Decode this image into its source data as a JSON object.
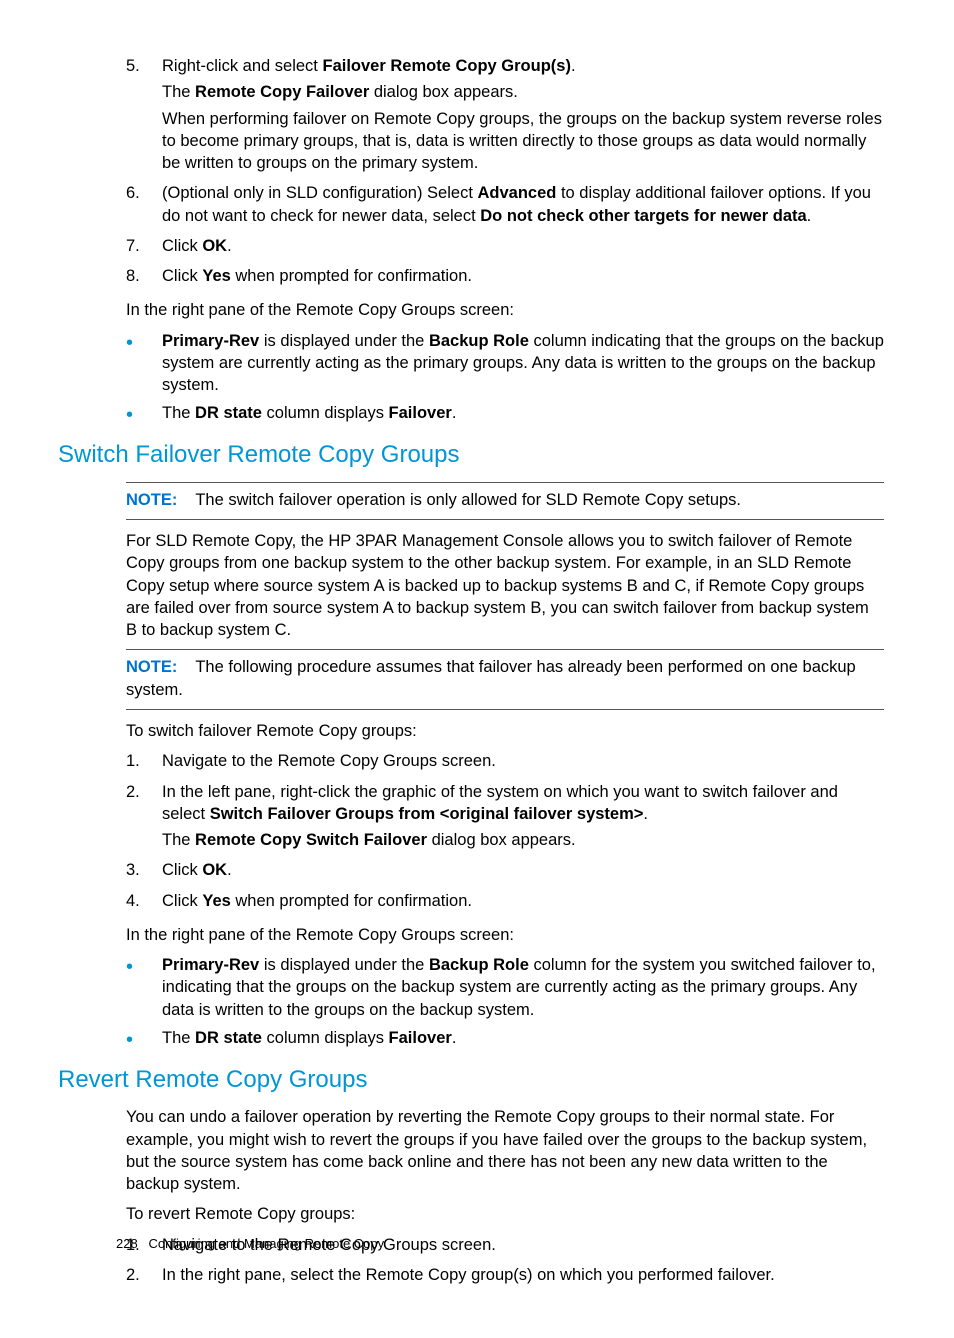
{
  "top_list": {
    "item5": {
      "num": "5.",
      "p1a": "Right-click and select ",
      "p1b": "Failover Remote Copy Group(s)",
      "p1c": ".",
      "p2a": "The ",
      "p2b": "Remote Copy Failover",
      "p2c": " dialog box appears.",
      "p3": "When performing failover on Remote Copy groups, the groups on the backup system reverse roles to become primary groups, that is, data is written directly to those groups as data would normally be written to groups on the primary system."
    },
    "item6": {
      "num": "6.",
      "p1a": "(Optional only in SLD configuration) Select ",
      "p1b": "Advanced",
      "p1c": " to display additional failover options. If you do not want to check for newer data, select ",
      "p1d": "Do not check other targets for newer data",
      "p1e": "."
    },
    "item7": {
      "num": "7.",
      "a": "Click ",
      "b": "OK",
      "c": "."
    },
    "item8": {
      "num": "8.",
      "a": "Click ",
      "b": "Yes",
      "c": " when prompted for confirmation."
    }
  },
  "top_after": {
    "intro": "In the right pane of the Remote Copy Groups screen:",
    "b1": {
      "a": "Primary-Rev",
      "b": " is displayed under the ",
      "c": "Backup Role",
      "d": " column indicating that the groups on the backup system are currently acting as the primary groups. Any data is written to the groups on the backup system."
    },
    "b2": {
      "a": "The ",
      "b": "DR state",
      "c": " column displays ",
      "d": "Failover",
      "e": "."
    }
  },
  "switch": {
    "heading": "Switch Failover Remote Copy Groups",
    "note1_label": "NOTE:",
    "note1_text": "The switch failover operation is only allowed for SLD Remote Copy setups.",
    "para1": "For SLD Remote Copy, the HP 3PAR Management Console allows you to switch failover of Remote Copy groups from one backup system to the other backup system. For example, in an SLD Remote Copy setup where source system A is backed up to backup systems B and C, if Remote Copy groups are failed over from source system A to backup system B, you can switch failover from backup system B to backup system C.",
    "note2_label": "NOTE:",
    "note2_text": "The following procedure assumes that failover has already been performed on one backup system.",
    "intro": "To switch failover Remote Copy groups:",
    "s1": {
      "num": "1.",
      "t": "Navigate to the Remote Copy Groups screen."
    },
    "s2": {
      "num": "2.",
      "a": "In the left pane, right-click the graphic of the system on which you want to switch failover and select ",
      "b": "Switch Failover Groups from <original failover system>",
      "c": ".",
      "p2a": "The ",
      "p2b": "Remote Copy Switch Failover",
      "p2c": " dialog box appears."
    },
    "s3": {
      "num": "3.",
      "a": "Click ",
      "b": "OK",
      "c": "."
    },
    "s4": {
      "num": "4.",
      "a": "Click ",
      "b": "Yes",
      "c": " when prompted for confirmation."
    },
    "after_intro": "In the right pane of the Remote Copy Groups screen:",
    "b1": {
      "a": "Primary-Rev",
      "b": " is displayed under the ",
      "c": "Backup Role",
      "d": " column for the system you switched failover to, indicating that the groups on the backup system are currently acting as the primary groups. Any data is written to the groups on the backup system."
    },
    "b2": {
      "a": "The ",
      "b": "DR state",
      "c": " column displays ",
      "d": "Failover",
      "e": "."
    }
  },
  "revert": {
    "heading": "Revert Remote Copy Groups",
    "para1": "You can undo a failover operation by reverting the Remote Copy groups to their normal state. For example, you might wish to revert the groups if you have failed over the groups to the backup system, but the source system has come back online and there has not been any new data written to the backup system.",
    "intro": "To revert Remote Copy groups:",
    "s1": {
      "num": "1.",
      "t": "Navigate to the Remote Copy Groups screen."
    },
    "s2": {
      "num": "2.",
      "t": "In the right pane, select the Remote Copy group(s) on which you performed failover."
    }
  },
  "footer": {
    "page": "228",
    "title": "Configuring and Managing Remote Copy"
  }
}
